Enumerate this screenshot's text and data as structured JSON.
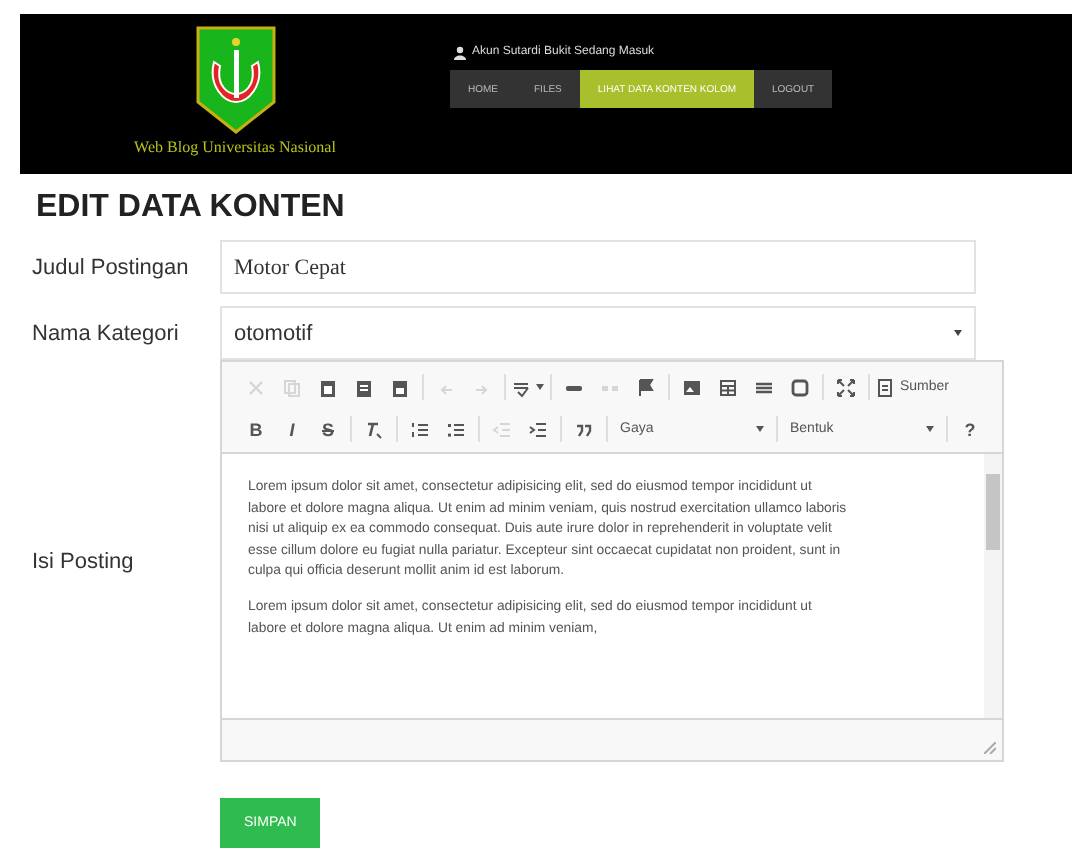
{
  "header": {
    "site_title": "Web Blog Universitas Nasional",
    "user_text": "Akun Sutardi Bukit Sedang Masuk",
    "nav": [
      {
        "label": "HOME",
        "selected": false
      },
      {
        "label": "FILES",
        "selected": false
      },
      {
        "label": "LIHAT DATA KONTEN KOLOM",
        "selected": true
      },
      {
        "label": "LOGOUT",
        "selected": false
      }
    ]
  },
  "page_title": "EDIT DATA KONTEN",
  "form": {
    "title": {
      "label": "Judul Postingan",
      "value": "Motor Cepat"
    },
    "category": {
      "label": "Nama Kategori",
      "value": "otomotif"
    },
    "body": {
      "label": "Isi Posting",
      "toolbar": [
        [
          [
            {
              "kind": "icon",
              "disabled": true
            },
            {
              "kind": "icon",
              "disabled": true
            },
            {
              "kind": "icon",
              "disabled": false
            },
            {
              "kind": "icon",
              "disabled": false
            },
            {
              "kind": "icon",
              "disabled": false
            }
          ],
          [
            {
              "kind": "icon",
              "disabled": true
            },
            {
              "kind": "icon",
              "disabled": true
            }
          ],
          [
            {
              "kind": "menu",
              "disabled": false
            }
          ],
          [
            {
              "kind": "icon",
              "disabled": false
            },
            {
              "kind": "icon",
              "disabled": true
            },
            {
              "kind": "icon",
              "disabled": false
            }
          ],
          [
            {
              "kind": "icon",
              "disabled": false
            },
            {
              "kind": "icon",
              "disabled": false
            },
            {
              "kind": "icon",
              "disabled": false
            },
            {
              "kind": "icon",
              "disabled": false
            }
          ],
          [
            {
              "kind": "icon",
              "disabled": false
            }
          ],
          [
            {
              "kind": "source",
              "label": "Sumber",
              "disabled": false
            }
          ]
        ],
        [
          [
            {
              "kind": "glyph",
              "text": "B",
              "disabled": false
            },
            {
              "kind": "glyph",
              "text": "I",
              "disabled": false
            },
            {
              "kind": "glyph",
              "text": "S",
              "disabled": false
            }
          ],
          [
            {
              "kind": "icon",
              "disabled": false
            }
          ],
          [
            {
              "kind": "icon",
              "disabled": false
            },
            {
              "kind": "icon",
              "disabled": false
            }
          ],
          [
            {
              "kind": "icon",
              "disabled": true
            },
            {
              "kind": "icon",
              "disabled": false
            }
          ],
          [
            {
              "kind": "icon",
              "disabled": false
            }
          ],
          [
            {
              "kind": "combo",
              "label": "Gaya",
              "disabled": false
            }
          ],
          [
            {
              "kind": "combo",
              "label": "Bentuk",
              "disabled": false
            }
          ],
          [
            {
              "kind": "glyph",
              "text": "?",
              "disabled": false
            }
          ]
        ]
      ],
      "paragraphs": [
        "Lorem ipsum dolor sit amet, consectetur adipisicing elit, sed do eiusmod tempor incididunt ut labore et dolore magna aliqua. Ut enim ad minim veniam, quis nostrud exercitation ullamco laboris nisi ut aliquip ex ea commodo consequat. Duis aute irure dolor in reprehenderit in voluptate velit esse cillum dolore eu fugiat nulla pariatur. Excepteur sint occaecat cupidatat non proident, sunt in culpa qui officia deserunt mollit anim id est laborum.",
        "Lorem ipsum dolor sit amet, consectetur adipisicing elit, sed do eiusmod tempor incididunt ut labore et dolore magna aliqua. Ut enim ad minim veniam,"
      ]
    },
    "submit": "SIMPAN"
  }
}
